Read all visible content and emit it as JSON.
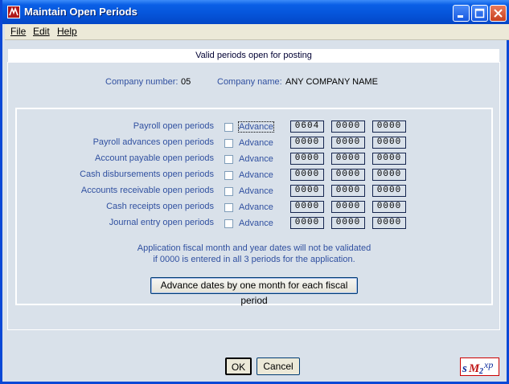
{
  "window": {
    "title": "Maintain Open Periods"
  },
  "menu": {
    "file": "File",
    "edit": "Edit",
    "help": "Help"
  },
  "banner": "Valid periods open for posting",
  "company": {
    "number_label": "Company number:",
    "number": "05",
    "name_label": "Company name:",
    "name": "ANY COMPANY NAME"
  },
  "periods": [
    {
      "label": "Payroll open periods",
      "advance_label": "Advance",
      "checked": false,
      "values": [
        "0604",
        "0000",
        "0000"
      ]
    },
    {
      "label": "Payroll advances open periods",
      "advance_label": "Advance",
      "checked": false,
      "values": [
        "0000",
        "0000",
        "0000"
      ]
    },
    {
      "label": "Account payable open periods",
      "advance_label": "Advance",
      "checked": false,
      "values": [
        "0000",
        "0000",
        "0000"
      ]
    },
    {
      "label": "Cash disbursements open periods",
      "advance_label": "Advance",
      "checked": false,
      "values": [
        "0000",
        "0000",
        "0000"
      ]
    },
    {
      "label": "Accounts receivable open periods",
      "advance_label": "Advance",
      "checked": false,
      "values": [
        "0000",
        "0000",
        "0000"
      ]
    },
    {
      "label": "Cash receipts open periods",
      "advance_label": "Advance",
      "checked": false,
      "values": [
        "0000",
        "0000",
        "0000"
      ]
    },
    {
      "label": "Journal entry open periods",
      "advance_label": "Advance",
      "checked": false,
      "values": [
        "0000",
        "0000",
        "0000"
      ]
    }
  ],
  "note": {
    "line1": "Application fiscal month and year dates will not be validated",
    "line2": "if 0000 is entered in all 3 periods for the application."
  },
  "buttons": {
    "advance_all": "Advance dates by one month for each fiscal period",
    "ok": "OK",
    "cancel": "Cancel"
  },
  "logo": {
    "text": "sM2xp"
  },
  "colors": {
    "titlebar": "#0554d9",
    "label": "#3050a0",
    "window_bg": "#d9e1ea"
  }
}
